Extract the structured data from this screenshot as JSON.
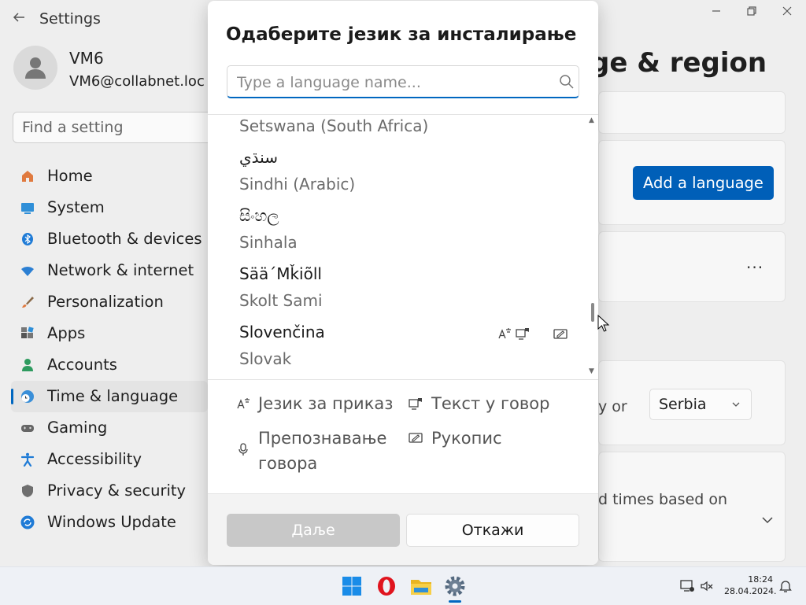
{
  "settings": {
    "app_title": "Settings",
    "user": {
      "name": "VM6",
      "email": "VM6@collabnet.loc"
    },
    "search_placeholder": "Find a setting",
    "nav": [
      {
        "label": "Home",
        "icon": "home-icon"
      },
      {
        "label": "System",
        "icon": "monitor-icon"
      },
      {
        "label": "Bluetooth & devices",
        "icon": "bluetooth-icon"
      },
      {
        "label": "Network & internet",
        "icon": "wifi-icon"
      },
      {
        "label": "Personalization",
        "icon": "brush-icon"
      },
      {
        "label": "Apps",
        "icon": "apps-icon"
      },
      {
        "label": "Accounts",
        "icon": "person-icon"
      },
      {
        "label": "Time & language",
        "icon": "globe-clock-icon",
        "selected": true
      },
      {
        "label": "Gaming",
        "icon": "gamepad-icon"
      },
      {
        "label": "Accessibility",
        "icon": "accessibility-icon"
      },
      {
        "label": "Privacy & security",
        "icon": "shield-icon"
      },
      {
        "label": "Windows Update",
        "icon": "update-icon"
      }
    ],
    "page_title_fragment": "ge & region",
    "add_language_label": "Add a language",
    "more_label": "...",
    "country_fragment": "y or",
    "region_value": "Serbia",
    "regional_format_fragment": "d times based on"
  },
  "dialog": {
    "title": "Одаберите језик за инсталирање",
    "search_placeholder": "Type a language name...",
    "languages": [
      {
        "native": "",
        "english": "Setswana (South Africa)"
      },
      {
        "native": "سنڌي",
        "english": "Sindhi (Arabic)"
      },
      {
        "native": "සිංහල",
        "english": "Sinhala"
      },
      {
        "native": "Sää´Mǩiõll",
        "english": "Skolt Sami"
      },
      {
        "native": "Slovenčina",
        "english": "Slovak",
        "features": [
          "display-language-icon",
          "text-to-speech-icon",
          "handwriting-icon"
        ]
      }
    ],
    "legend": {
      "display_language": "Језик за приказ",
      "text_to_speech": "Текст у говор",
      "speech_recognition_line1": "Препознавање",
      "speech_recognition_line2": "говора",
      "handwriting": "Рукопис"
    },
    "buttons": {
      "next": "Даље",
      "cancel": "Откажи"
    }
  },
  "taskbar": {
    "apps": [
      "windows-start-icon",
      "opera-icon",
      "file-explorer-icon",
      "settings-gear-icon"
    ],
    "time": "18:24",
    "date": "28.04.2024."
  },
  "colors": {
    "accent": "#0067c0",
    "button_primary": "#005fb8",
    "disabled_button": "#c8c8c8"
  }
}
